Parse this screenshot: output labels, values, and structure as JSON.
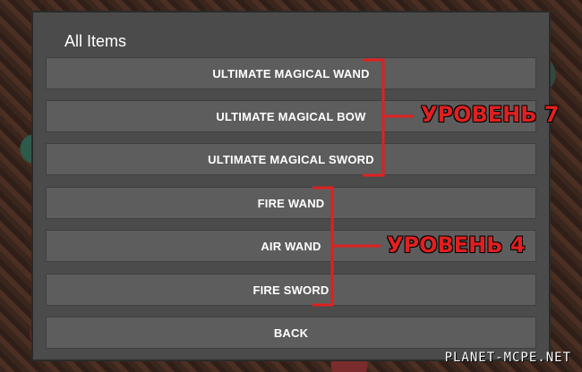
{
  "dialog": {
    "title": "All Items",
    "buttons": [
      {
        "label": "ULTIMATE MAGICAL WAND"
      },
      {
        "label": "ULTIMATE MAGICAL BOW"
      },
      {
        "label": "ULTIMATE MAGICAL SWORD"
      },
      {
        "label": "FIRE WAND"
      },
      {
        "label": "AIR WAND"
      },
      {
        "label": "FIRE SWORD"
      },
      {
        "label": "BACK"
      }
    ]
  },
  "annotations": {
    "level7": "УРОВЕНЬ 7",
    "level4": "УРОВЕНЬ 4",
    "color": "#e02020"
  },
  "watermark": "PLANET-MCPE.NET"
}
